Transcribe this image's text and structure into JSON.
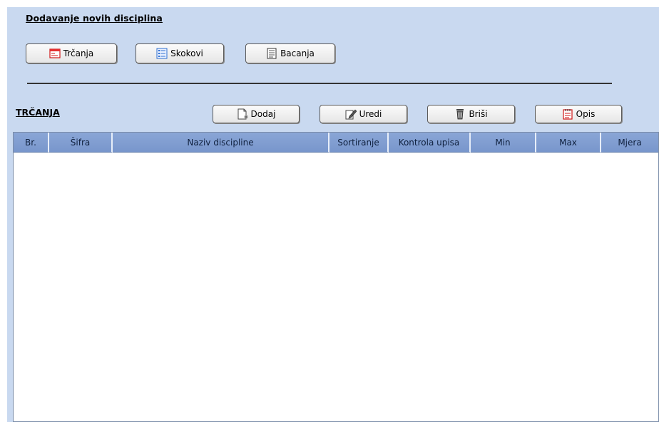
{
  "add_section": {
    "title": "Dodavanje novih disciplina",
    "buttons": [
      {
        "label": "Trčanja",
        "icon": "form-icon"
      },
      {
        "label": "Skokovi",
        "icon": "list-icon"
      },
      {
        "label": "Bacanja",
        "icon": "document-icon"
      }
    ]
  },
  "list_section": {
    "title": "TRČANJA",
    "actions": {
      "add": "Dodaj",
      "edit": "Uredi",
      "delete": "Briši",
      "describe": "Opis"
    }
  },
  "table": {
    "columns": [
      "Br.",
      "Šifra",
      "Naziv discipline",
      "Sortiranje",
      "Kontrola upisa",
      "Min",
      "Max",
      "Mjera"
    ],
    "rows": []
  },
  "colors": {
    "panel_bg": "#c9d9f0",
    "header_bg": "#7f9cd0"
  }
}
